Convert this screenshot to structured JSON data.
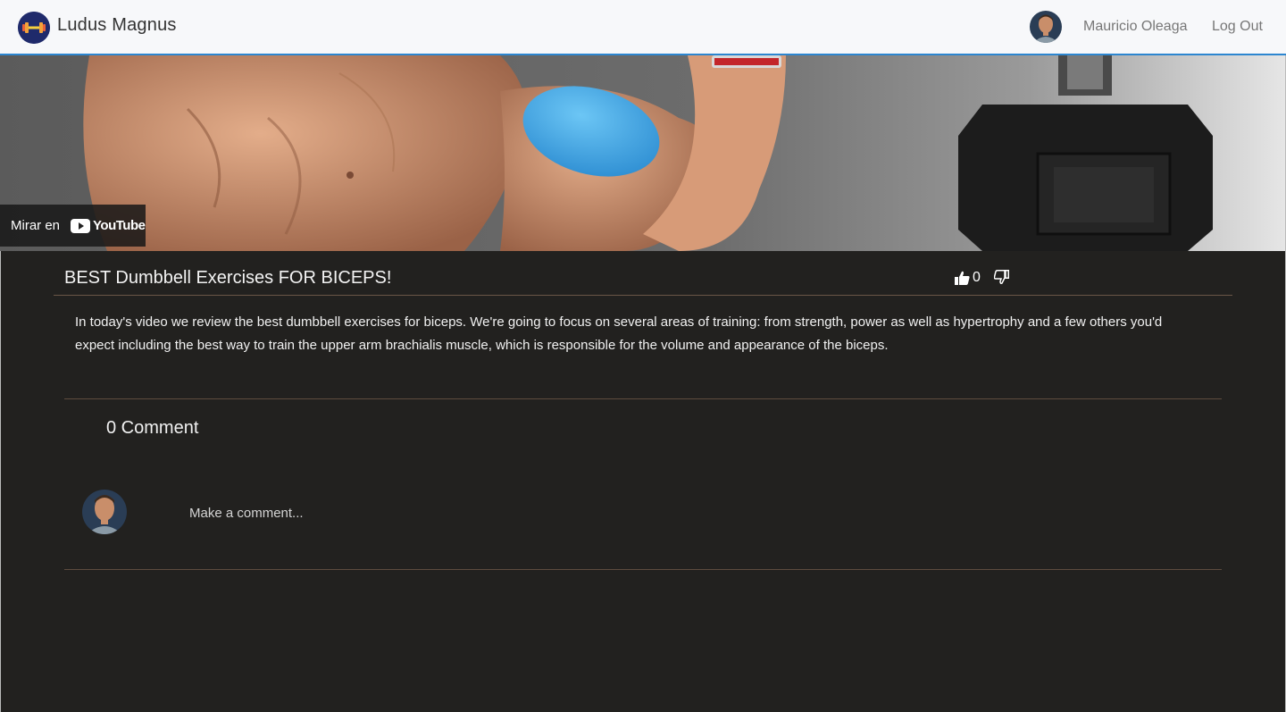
{
  "navbar": {
    "brand": "Ludus Magnus",
    "user_name": "Mauricio Oleaga",
    "logout_label": "Log Out"
  },
  "video": {
    "watch_on_label": "Mirar en",
    "platform": "YouTube"
  },
  "post": {
    "title": "BEST Dumbbell Exercises FOR BICEPS!",
    "likes": "0",
    "description": "In today's video we review the best dumbbell exercises for biceps. We're going to focus on several areas of training: from strength, power as well as hypertrophy and a few others you'd expect including the best way to train the upper arm brachialis muscle, which is responsible for the volume and appearance of the biceps."
  },
  "comments": {
    "count_label": "0 Comment",
    "input_placeholder": "Make a comment..."
  },
  "colors": {
    "navbar_bg": "#f7f8fa",
    "accent_border": "#2c86d0",
    "page_bg": "#22211f",
    "divider": "#5e4c3e"
  },
  "icons": [
    "dumbbell-logo-icon",
    "thumbs-up-icon",
    "thumbs-down-icon",
    "youtube-play-icon"
  ]
}
